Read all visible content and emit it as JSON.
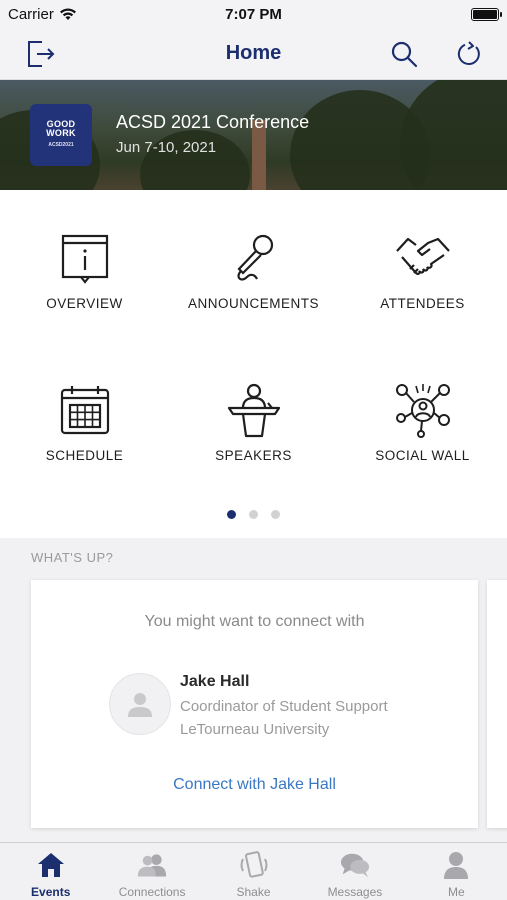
{
  "status_bar": {
    "carrier": "Carrier",
    "time": "7:07 PM"
  },
  "nav": {
    "title": "Home",
    "left_icon": "logout-icon",
    "right_icons": [
      "search-icon",
      "refresh-icon"
    ]
  },
  "banner": {
    "logo_line1": "GOOD",
    "logo_line2": "WORK",
    "logo_line3": "ACSD2021",
    "title": "ACSD 2021 Conference",
    "date": "Jun 7-10, 2021"
  },
  "menu": {
    "items": [
      {
        "label": "OVERVIEW",
        "icon": "info-board-icon"
      },
      {
        "label": "ANNOUNCEMENTS",
        "icon": "microphone-icon"
      },
      {
        "label": "ATTENDEES",
        "icon": "handshake-icon"
      },
      {
        "label": "SCHEDULE",
        "icon": "calendar-icon"
      },
      {
        "label": "SPEAKERS",
        "icon": "podium-icon"
      },
      {
        "label": "SOCIAL WALL",
        "icon": "network-icon"
      }
    ],
    "page_indicator": {
      "pages": 3,
      "active": 1
    }
  },
  "whatsup": {
    "header": "WHAT'S UP?",
    "card": {
      "intro": "You might want to connect with",
      "name": "Jake Hall",
      "role": "Coordinator of Student Support",
      "organization": "LeTourneau University",
      "action": "Connect with Jake Hall"
    }
  },
  "tabs": [
    {
      "label": "Events",
      "icon": "home-icon",
      "active": true
    },
    {
      "label": "Connections",
      "icon": "connections-icon",
      "active": false
    },
    {
      "label": "Shake",
      "icon": "shake-phone-icon",
      "active": false
    },
    {
      "label": "Messages",
      "icon": "messages-icon",
      "active": false
    },
    {
      "label": "Me",
      "icon": "profile-icon",
      "active": false
    }
  ],
  "colors": {
    "accent": "#1b2f6e",
    "link": "#3a78c4",
    "background": "#f1f1f3"
  }
}
